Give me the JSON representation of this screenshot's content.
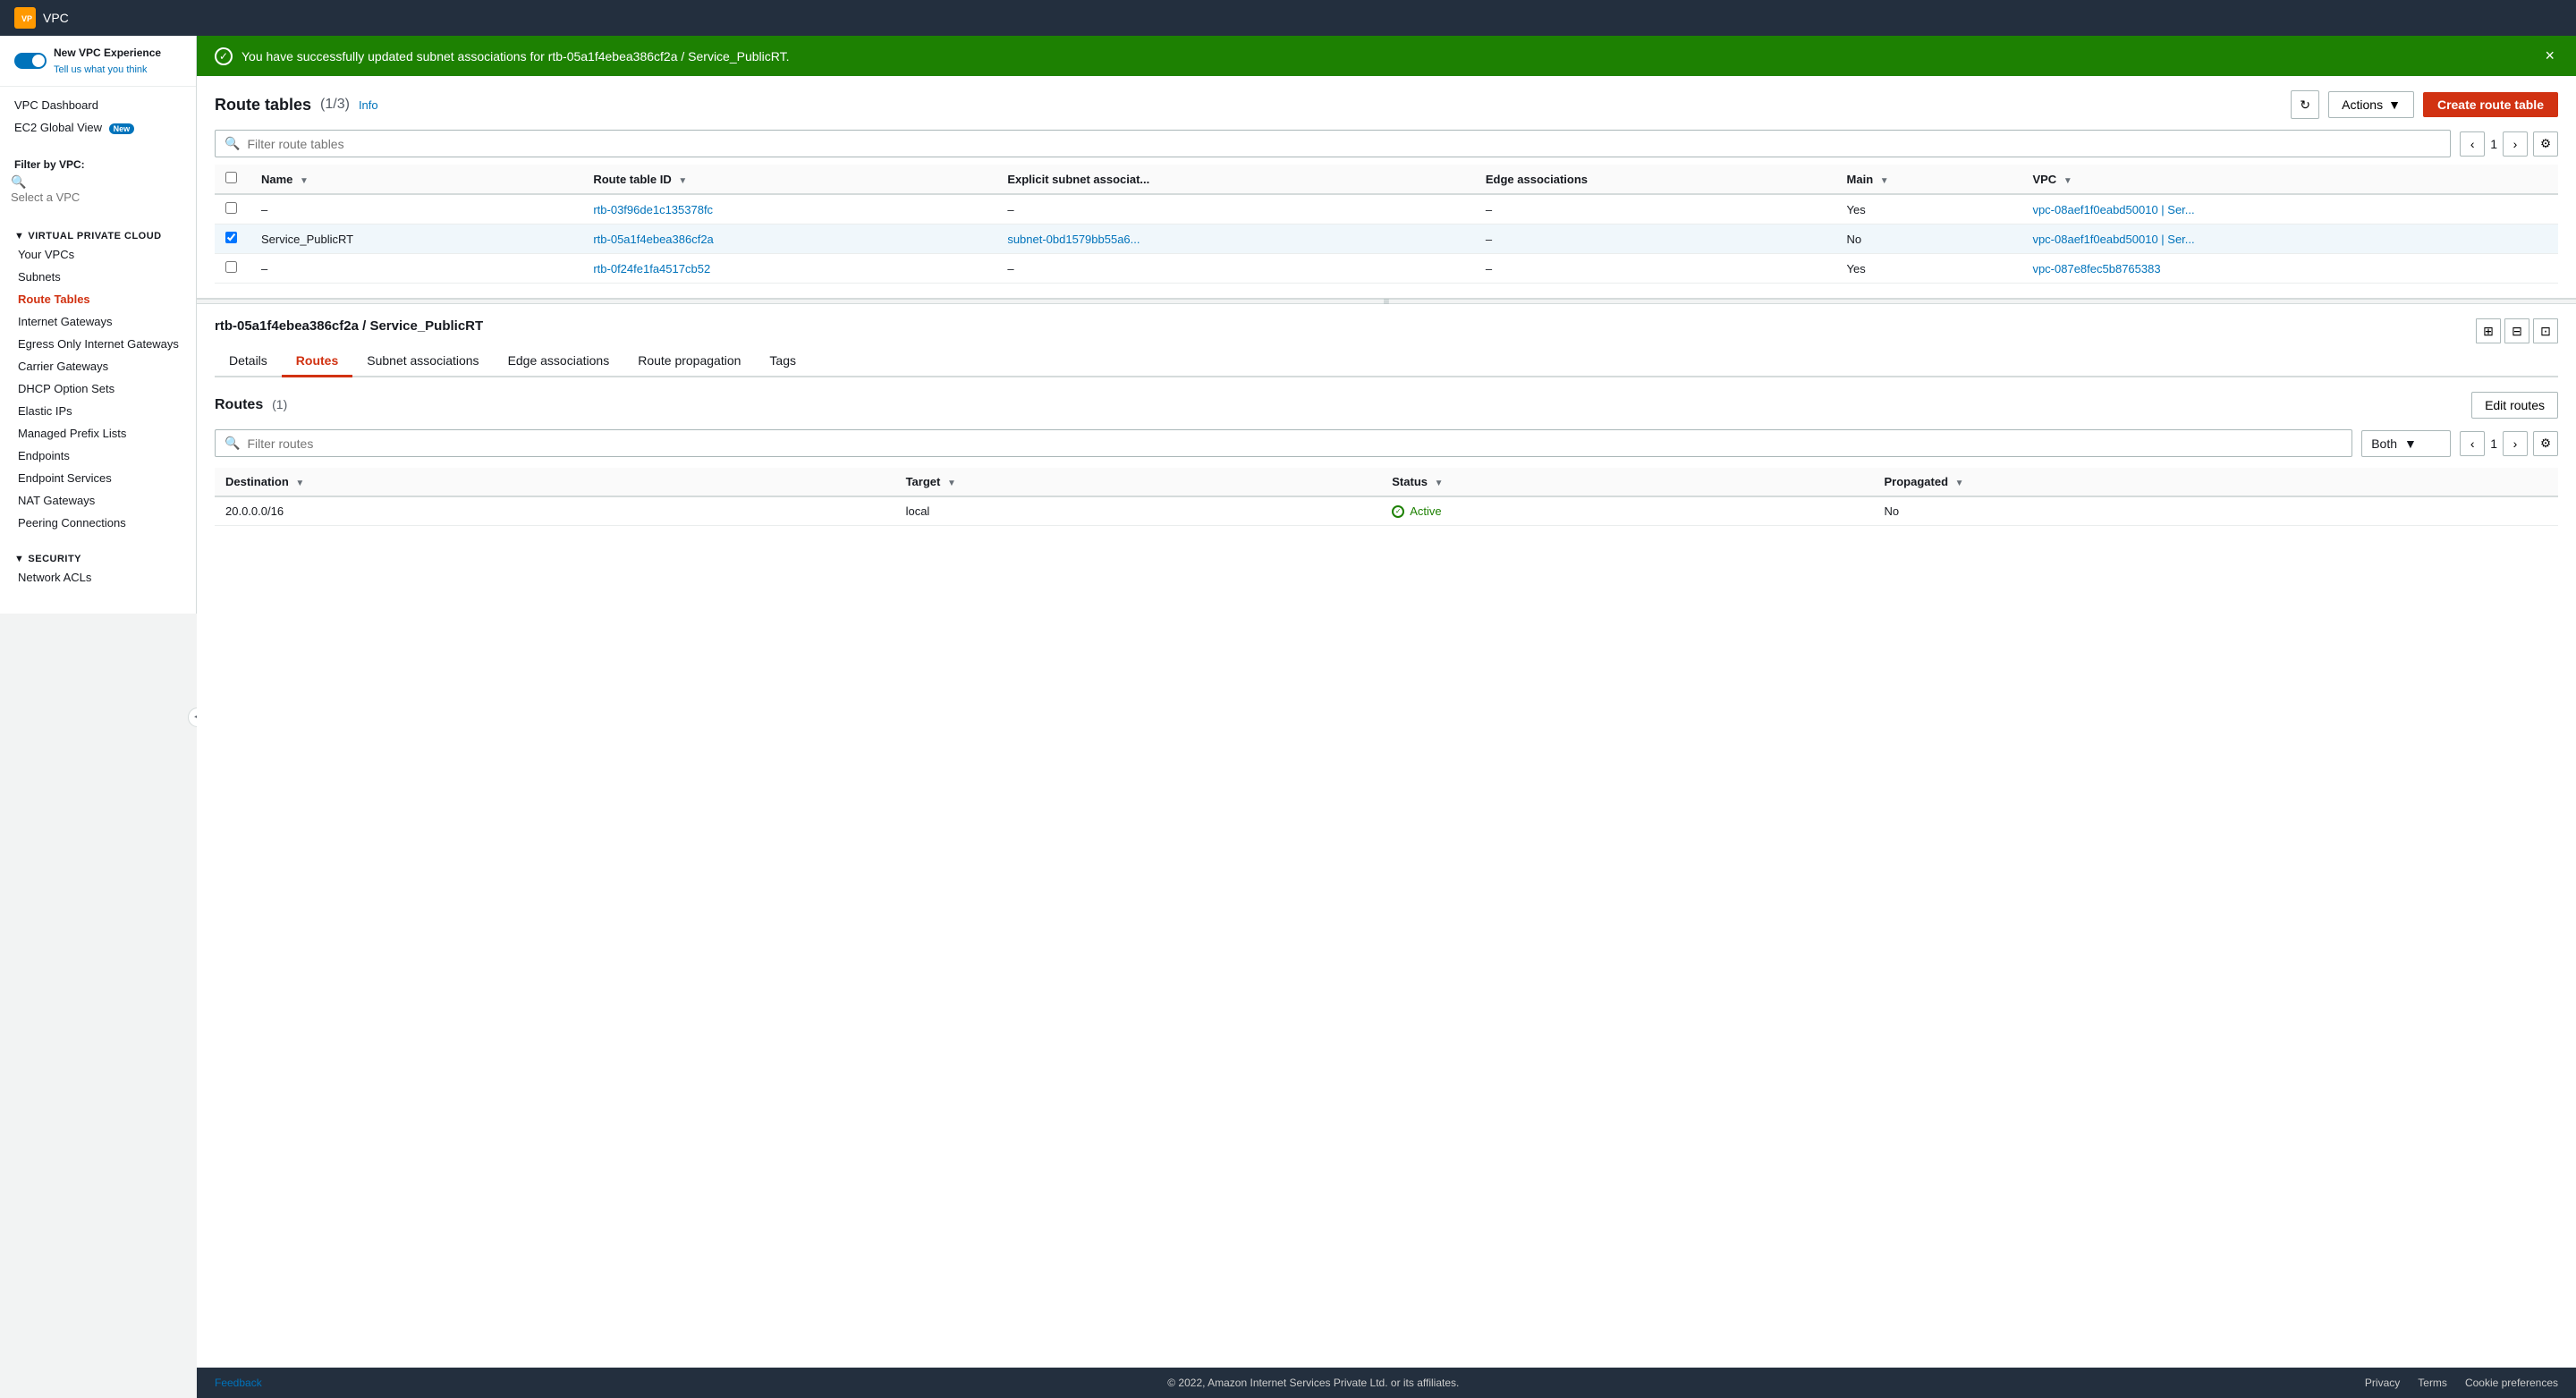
{
  "topbar": {
    "service_name": "VPC",
    "logo_text": "VPC"
  },
  "sidebar": {
    "toggle_label": "New VPC Experience",
    "toggle_link": "Tell us what you think",
    "filter_vpc_label": "Filter by VPC:",
    "filter_vpc_placeholder": "Select a VPC",
    "sections": [
      {
        "id": "vpc",
        "label": "VIRTUAL PRIVATE CLOUD",
        "items": [
          {
            "id": "your-vpcs",
            "label": "Your VPCs",
            "active": false
          },
          {
            "id": "subnets",
            "label": "Subnets",
            "active": false
          },
          {
            "id": "route-tables",
            "label": "Route Tables",
            "active": true
          },
          {
            "id": "internet-gateways",
            "label": "Internet Gateways",
            "active": false
          },
          {
            "id": "egress-gateways",
            "label": "Egress Only Internet Gateways",
            "active": false
          },
          {
            "id": "carrier-gateways",
            "label": "Carrier Gateways",
            "active": false
          },
          {
            "id": "dhcp-options",
            "label": "DHCP Option Sets",
            "active": false
          },
          {
            "id": "elastic-ips",
            "label": "Elastic IPs",
            "active": false
          },
          {
            "id": "managed-prefix",
            "label": "Managed Prefix Lists",
            "active": false
          },
          {
            "id": "endpoints",
            "label": "Endpoints",
            "active": false
          },
          {
            "id": "endpoint-services",
            "label": "Endpoint Services",
            "active": false
          },
          {
            "id": "nat-gateways",
            "label": "NAT Gateways",
            "active": false
          },
          {
            "id": "peering-connections",
            "label": "Peering Connections",
            "active": false
          }
        ]
      },
      {
        "id": "security",
        "label": "SECURITY",
        "items": [
          {
            "id": "network-acls",
            "label": "Network ACLs",
            "active": false
          }
        ]
      }
    ],
    "nav_items": [
      {
        "id": "vpc-dashboard",
        "label": "VPC Dashboard"
      },
      {
        "id": "ec2-global-view",
        "label": "EC2 Global View",
        "is_new": true
      }
    ]
  },
  "success_banner": {
    "message": "You have successfully updated subnet associations for rtb-05a1f4ebea386cf2a / Service_PublicRT.",
    "close_label": "×"
  },
  "route_tables": {
    "title": "Route tables",
    "count": "(1/3)",
    "info_label": "Info",
    "search_placeholder": "Filter route tables",
    "page_number": "1",
    "columns": [
      {
        "id": "name",
        "label": "Name"
      },
      {
        "id": "route-table-id",
        "label": "Route table ID"
      },
      {
        "id": "explicit-subnet",
        "label": "Explicit subnet associat..."
      },
      {
        "id": "edge-assoc",
        "label": "Edge associations"
      },
      {
        "id": "main",
        "label": "Main"
      },
      {
        "id": "vpc",
        "label": "VPC"
      }
    ],
    "rows": [
      {
        "id": "row-1",
        "checkbox": false,
        "name": "–",
        "route_table_id": "rtb-03f96de1c135378fc",
        "explicit_subnet": "–",
        "edge_associations": "–",
        "main": "Yes",
        "vpc": "vpc-08aef1f0eabd50010 | Ser...",
        "selected": false
      },
      {
        "id": "row-2",
        "checkbox": true,
        "name": "Service_PublicRT",
        "route_table_id": "rtb-05a1f4ebea386cf2a",
        "explicit_subnet": "subnet-0bd1579bb55a6...",
        "edge_associations": "–",
        "main": "No",
        "vpc": "vpc-08aef1f0eabd50010 | Ser...",
        "selected": true
      },
      {
        "id": "row-3",
        "checkbox": false,
        "name": "–",
        "route_table_id": "rtb-0f24fe1fa4517cb52",
        "explicit_subnet": "–",
        "edge_associations": "–",
        "main": "Yes",
        "vpc": "vpc-087e8fec5b8765383",
        "selected": false
      }
    ]
  },
  "detail_panel": {
    "title": "rtb-05a1f4ebea386cf2a / Service_PublicRT",
    "tabs": [
      {
        "id": "details",
        "label": "Details",
        "active": false
      },
      {
        "id": "routes",
        "label": "Routes",
        "active": true
      },
      {
        "id": "subnet-associations",
        "label": "Subnet associations",
        "active": false
      },
      {
        "id": "edge-associations",
        "label": "Edge associations",
        "active": false
      },
      {
        "id": "route-propagation",
        "label": "Route propagation",
        "active": false
      },
      {
        "id": "tags",
        "label": "Tags",
        "active": false
      }
    ],
    "routes_section": {
      "title": "Routes",
      "count": "(1)",
      "edit_btn_label": "Edit routes",
      "filter_placeholder": "Filter routes",
      "dropdown_label": "Both",
      "page_number": "1",
      "columns": [
        {
          "id": "destination",
          "label": "Destination"
        },
        {
          "id": "target",
          "label": "Target"
        },
        {
          "id": "status",
          "label": "Status"
        },
        {
          "id": "propagated",
          "label": "Propagated"
        }
      ],
      "rows": [
        {
          "id": "route-row-1",
          "destination": "20.0.0.0/16",
          "target": "local",
          "status": "Active",
          "propagated": "No"
        }
      ]
    }
  },
  "footer": {
    "copyright": "© 2022, Amazon Internet Services Private Ltd. or its affiliates.",
    "links": [
      "Privacy",
      "Terms",
      "Cookie preferences"
    ]
  },
  "actions_btn_label": "Actions",
  "create_btn_label": "Create route table",
  "feedback_label": "Feedback"
}
